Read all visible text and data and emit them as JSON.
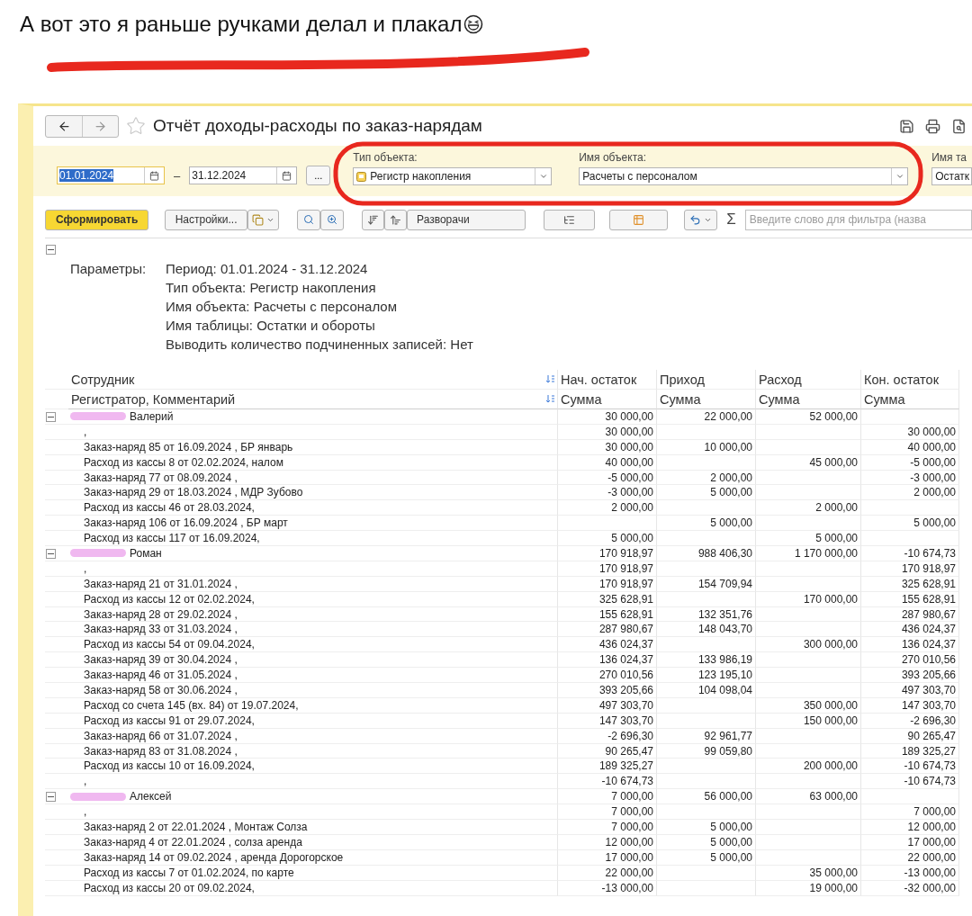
{
  "caption": {
    "text": "А вот это я раньше ручками делал и плакал"
  },
  "window": {
    "title": "Отчёт доходы-расходы по заказ-нарядам",
    "favorite": false
  },
  "filters": {
    "date_from": {
      "value": "01.01.2024",
      "focused": true
    },
    "dash": "–",
    "date_to": {
      "value": "31.12.2024",
      "focused": false
    },
    "more_button": "...",
    "fields": [
      {
        "label": "Тип объекта:",
        "value": "Регистр накопления",
        "kind": "register"
      },
      {
        "label": "Имя объекта:",
        "value": "Расчеты с персоналом",
        "kind": "plain"
      },
      {
        "label": "Имя та",
        "value": "Остатк",
        "kind": "cut"
      }
    ]
  },
  "toolbar": {
    "generate_button": "Сформировать",
    "settings_button": "Настройки...",
    "expand_button": "Разворачи",
    "sigma": "Σ",
    "filter_placeholder": "Введите слово для фильтра (назва"
  },
  "parameters": {
    "expanded": true,
    "label": "Параметры:",
    "lines": [
      "Период: 01.01.2024 - 31.12.2024",
      "Тип объекта: Регистр накопления",
      "Имя объекта: Расчеты с персоналом",
      "Имя таблицы: Остатки и обороты",
      "Выводить количество подчиненных записей: Нет"
    ]
  },
  "table": {
    "columns": [
      {
        "top": "Сотрудник",
        "bottom": "Регистратор, Комментарий"
      },
      {
        "top": "Нач. остаток",
        "bottom": "Сумма"
      },
      {
        "top": "Приход",
        "bottom": "Сумма"
      },
      {
        "top": "Расход",
        "bottom": "Сумма"
      },
      {
        "top": "Кон. остаток",
        "bottom": "Сумма"
      }
    ],
    "groups": [
      {
        "name": "Валерий",
        "expanded": true,
        "start": "30 000,00",
        "income": "22 000,00",
        "expense": "52 000,00",
        "children": [
          {
            "label": ",",
            "start": "30 000,00",
            "end": "30 000,00"
          },
          {
            "label": "Заказ-наряд 85 от 16.09.2024 , БР январь",
            "start": "30 000,00",
            "income": "10 000,00",
            "end": "40 000,00"
          },
          {
            "label": "Расход из кассы 8 от 02.02.2024, налом",
            "start": "40 000,00",
            "expense": "45 000,00",
            "end": "-5 000,00"
          },
          {
            "label": "Заказ-наряд 77 от 08.09.2024 ,",
            "start": "-5 000,00",
            "income": "2 000,00",
            "end": "-3 000,00"
          },
          {
            "label": "Заказ-наряд 29 от 18.03.2024 , МДР Зубово",
            "start": "-3 000,00",
            "income": "5 000,00",
            "end": "2 000,00"
          },
          {
            "label": "Расход из кассы 46 от 28.03.2024,",
            "start": "2 000,00",
            "expense": "2 000,00"
          },
          {
            "label": "Заказ-наряд 106 от 16.09.2024 , БР март",
            "income": "5 000,00",
            "end": "5 000,00"
          },
          {
            "label": "Расход из кассы 117 от 16.09.2024,",
            "start": "5 000,00",
            "expense": "5 000,00"
          }
        ]
      },
      {
        "name": "Роман",
        "expanded": true,
        "start": "170 918,97",
        "income": "988 406,30",
        "expense": "1 170 000,00",
        "end": "-10 674,73",
        "children": [
          {
            "label": ",",
            "start": "170 918,97",
            "end": "170 918,97"
          },
          {
            "label": "Заказ-наряд 21 от 31.01.2024 ,",
            "start": "170 918,97",
            "income": "154 709,94",
            "end": "325 628,91"
          },
          {
            "label": "Расход из кассы 12 от 02.02.2024,",
            "start": "325 628,91",
            "expense": "170 000,00",
            "end": "155 628,91"
          },
          {
            "label": "Заказ-наряд 28 от 29.02.2024 ,",
            "start": "155 628,91",
            "income": "132 351,76",
            "end": "287 980,67"
          },
          {
            "label": "Заказ-наряд 33 от 31.03.2024 ,",
            "start": "287 980,67",
            "income": "148 043,70",
            "end": "436 024,37"
          },
          {
            "label": "Расход из кассы 54 от 09.04.2024,",
            "start": "436 024,37",
            "expense": "300 000,00",
            "end": "136 024,37"
          },
          {
            "label": "Заказ-наряд 39 от 30.04.2024 ,",
            "start": "136 024,37",
            "income": "133 986,19",
            "end": "270 010,56"
          },
          {
            "label": "Заказ-наряд 46 от 31.05.2024 ,",
            "start": "270 010,56",
            "income": "123 195,10",
            "end": "393 205,66"
          },
          {
            "label": "Заказ-наряд 58 от 30.06.2024 ,",
            "start": "393 205,66",
            "income": "104 098,04",
            "end": "497 303,70"
          },
          {
            "label": "Расход со счета 145 (вх. 84) от 19.07.2024,",
            "start": "497 303,70",
            "expense": "350 000,00",
            "end": "147 303,70"
          },
          {
            "label": "Расход из кассы 91 от 29.07.2024,",
            "start": "147 303,70",
            "expense": "150 000,00",
            "end": "-2 696,30"
          },
          {
            "label": "Заказ-наряд 66 от 31.07.2024 ,",
            "start": "-2 696,30",
            "income": "92 961,77",
            "end": "90 265,47"
          },
          {
            "label": "Заказ-наряд 83 от 31.08.2024 ,",
            "start": "90 265,47",
            "income": "99 059,80",
            "end": "189 325,27"
          },
          {
            "label": "Расход из кассы 10 от 16.09.2024,",
            "start": "189 325,27",
            "expense": "200 000,00",
            "end": "-10 674,73"
          },
          {
            "label": ",",
            "start": "-10 674,73",
            "end": "-10 674,73"
          }
        ]
      },
      {
        "name": "Алексей",
        "expanded": true,
        "start": "7 000,00",
        "income": "56 000,00",
        "expense": "63 000,00",
        "children": [
          {
            "label": ",",
            "start": "7 000,00",
            "end": "7 000,00"
          },
          {
            "label": "Заказ-наряд 2 от 22.01.2024 , Монтаж Солза",
            "start": "7 000,00",
            "income": "5 000,00",
            "end": "12 000,00"
          },
          {
            "label": "Заказ-наряд 4 от 22.01.2024 , солза аренда",
            "start": "12 000,00",
            "income": "5 000,00",
            "end": "17 000,00"
          },
          {
            "label": "Заказ-наряд 14 от 09.02.2024 , аренда Дорогорское",
            "start": "17 000,00",
            "income": "5 000,00",
            "end": "22 000,00"
          },
          {
            "label": "Расход из кассы 7 от 01.02.2024, по карте",
            "start": "22 000,00",
            "expense": "35 000,00",
            "end": "-13 000,00"
          },
          {
            "label": "Расход из кассы 20 от 09.02.2024,",
            "start": "-13 000,00",
            "expense": "19 000,00",
            "end": "-32 000,00"
          }
        ]
      }
    ]
  }
}
